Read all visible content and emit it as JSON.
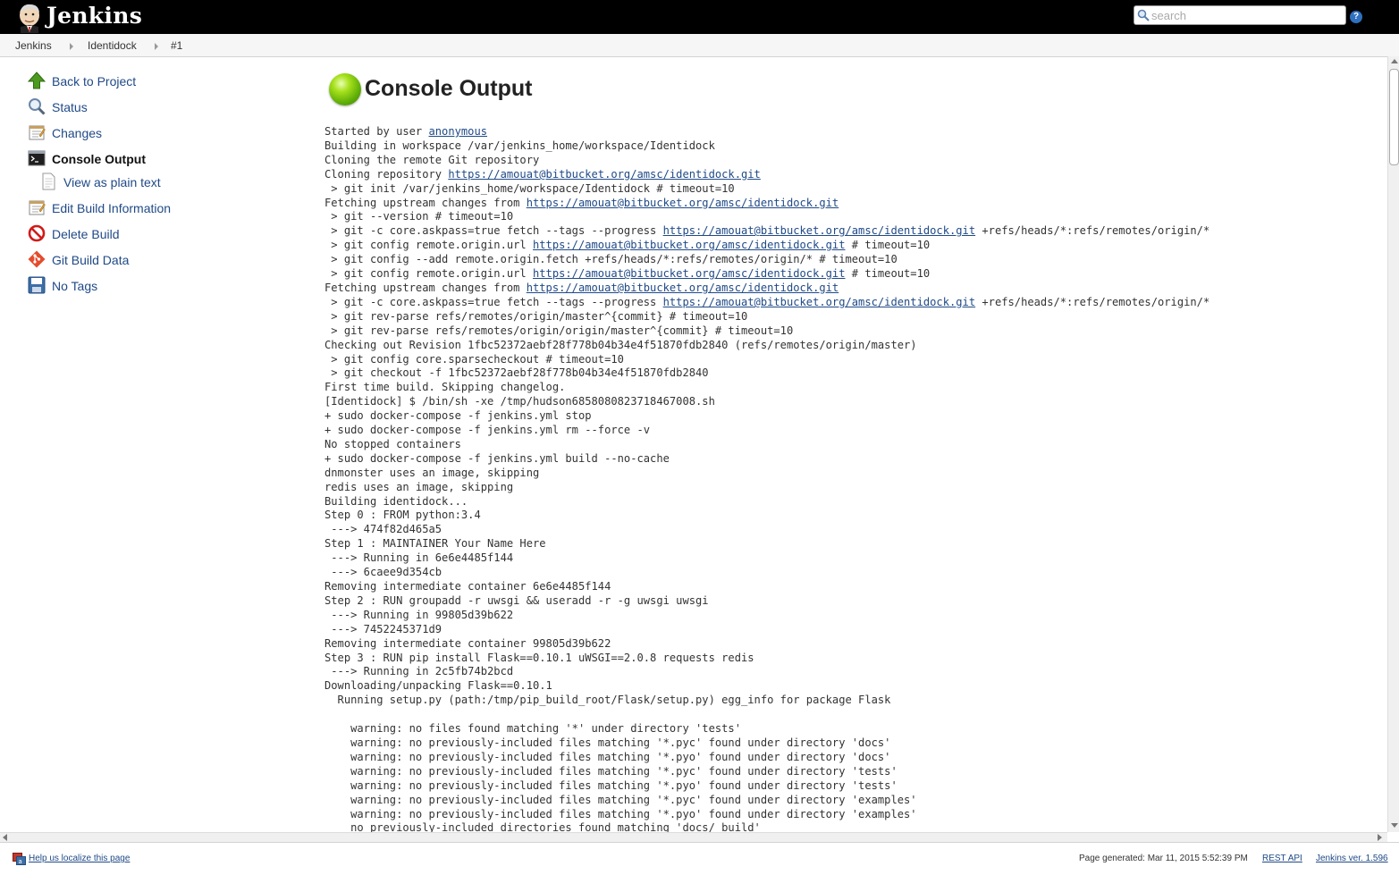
{
  "header": {
    "logo_text": "Jenkins",
    "search_placeholder": "search",
    "help_label": "?"
  },
  "breadcrumb": [
    "Jenkins",
    "Identidock",
    "#1"
  ],
  "sidebar": {
    "items": [
      {
        "label": "Back to Project",
        "icon": "up-arrow-icon"
      },
      {
        "label": "Status",
        "icon": "magnifier-icon"
      },
      {
        "label": "Changes",
        "icon": "notepad-icon"
      },
      {
        "label": "Console Output",
        "icon": "terminal-icon",
        "active": true
      },
      {
        "label": "View as plain text",
        "icon": "document-icon"
      },
      {
        "label": "Edit Build Information",
        "icon": "notepad-icon"
      },
      {
        "label": "Delete Build",
        "icon": "no-entry-icon"
      },
      {
        "label": "Git Build Data",
        "icon": "git-icon"
      },
      {
        "label": "No Tags",
        "icon": "save-icon"
      }
    ]
  },
  "main": {
    "title": "Console Output",
    "status_color": "#6cbf0c"
  },
  "console": {
    "lines": [
      [
        [
          "Started by user ",
          ""
        ],
        [
          "anonymous",
          "link"
        ]
      ],
      [
        [
          "Building in workspace /var/jenkins_home/workspace/Identidock",
          ""
        ]
      ],
      [
        [
          "Cloning the remote Git repository",
          ""
        ]
      ],
      [
        [
          "Cloning repository ",
          ""
        ],
        [
          "https://amouat@bitbucket.org/amsc/identidock.git",
          "link"
        ]
      ],
      [
        [
          " > git init /var/jenkins_home/workspace/Identidock # timeout=10",
          ""
        ]
      ],
      [
        [
          "Fetching upstream changes from ",
          ""
        ],
        [
          "https://amouat@bitbucket.org/amsc/identidock.git",
          "link"
        ]
      ],
      [
        [
          " > git --version # timeout=10",
          ""
        ]
      ],
      [
        [
          " > git -c core.askpass=true fetch --tags --progress ",
          ""
        ],
        [
          "https://amouat@bitbucket.org/amsc/identidock.git",
          "link"
        ],
        [
          " +refs/heads/*:refs/remotes/origin/*",
          ""
        ]
      ],
      [
        [
          " > git config remote.origin.url ",
          ""
        ],
        [
          "https://amouat@bitbucket.org/amsc/identidock.git",
          "link"
        ],
        [
          " # timeout=10",
          ""
        ]
      ],
      [
        [
          " > git config --add remote.origin.fetch +refs/heads/*:refs/remotes/origin/* # timeout=10",
          ""
        ]
      ],
      [
        [
          " > git config remote.origin.url ",
          ""
        ],
        [
          "https://amouat@bitbucket.org/amsc/identidock.git",
          "link"
        ],
        [
          " # timeout=10",
          ""
        ]
      ],
      [
        [
          "Fetching upstream changes from ",
          ""
        ],
        [
          "https://amouat@bitbucket.org/amsc/identidock.git",
          "link"
        ]
      ],
      [
        [
          " > git -c core.askpass=true fetch --tags --progress ",
          ""
        ],
        [
          "https://amouat@bitbucket.org/amsc/identidock.git",
          "link"
        ],
        [
          " +refs/heads/*:refs/remotes/origin/*",
          ""
        ]
      ],
      [
        [
          " > git rev-parse refs/remotes/origin/master^{commit} # timeout=10",
          ""
        ]
      ],
      [
        [
          " > git rev-parse refs/remotes/origin/origin/master^{commit} # timeout=10",
          ""
        ]
      ],
      [
        [
          "Checking out Revision 1fbc52372aebf28f778b04b34e4f51870fdb2840 (refs/remotes/origin/master)",
          ""
        ]
      ],
      [
        [
          " > git config core.sparsecheckout # timeout=10",
          ""
        ]
      ],
      [
        [
          " > git checkout -f 1fbc52372aebf28f778b04b34e4f51870fdb2840",
          ""
        ]
      ],
      [
        [
          "First time build. Skipping changelog.",
          ""
        ]
      ],
      [
        [
          "[Identidock] $ /bin/sh -xe /tmp/hudson6858080823718467008.sh",
          ""
        ]
      ],
      [
        [
          "+ sudo docker-compose -f jenkins.yml stop",
          ""
        ]
      ],
      [
        [
          "+ sudo docker-compose -f jenkins.yml rm --force -v",
          ""
        ]
      ],
      [
        [
          "No stopped containers",
          ""
        ]
      ],
      [
        [
          "+ sudo docker-compose -f jenkins.yml build --no-cache",
          ""
        ]
      ],
      [
        [
          "dnmonster uses an image, skipping",
          ""
        ]
      ],
      [
        [
          "redis uses an image, skipping",
          ""
        ]
      ],
      [
        [
          "Building identidock...",
          ""
        ]
      ],
      [
        [
          "Step 0 : FROM python:3.4",
          ""
        ]
      ],
      [
        [
          " ---> 474f82d465a5",
          ""
        ]
      ],
      [
        [
          "Step 1 : MAINTAINER Your Name Here",
          ""
        ]
      ],
      [
        [
          " ---> Running in 6e6e4485f144",
          ""
        ]
      ],
      [
        [
          " ---> 6caee9d354cb",
          ""
        ]
      ],
      [
        [
          "Removing intermediate container 6e6e4485f144",
          ""
        ]
      ],
      [
        [
          "Step 2 : RUN groupadd -r uwsgi && useradd -r -g uwsgi uwsgi",
          ""
        ]
      ],
      [
        [
          " ---> Running in 99805d39b622",
          ""
        ]
      ],
      [
        [
          " ---> 7452245371d9",
          ""
        ]
      ],
      [
        [
          "Removing intermediate container 99805d39b622",
          ""
        ]
      ],
      [
        [
          "Step 3 : RUN pip install Flask==0.10.1 uWSGI==2.0.8 requests redis",
          ""
        ]
      ],
      [
        [
          " ---> Running in 2c5fb74b2bcd",
          ""
        ]
      ],
      [
        [
          "Downloading/unpacking Flask==0.10.1",
          ""
        ]
      ],
      [
        [
          "  Running setup.py (path:/tmp/pip_build_root/Flask/setup.py) egg_info for package Flask",
          ""
        ]
      ],
      [
        [
          "",
          ""
        ]
      ],
      [
        [
          "    warning: no files found matching '*' under directory 'tests'",
          ""
        ]
      ],
      [
        [
          "    warning: no previously-included files matching '*.pyc' found under directory 'docs'",
          ""
        ]
      ],
      [
        [
          "    warning: no previously-included files matching '*.pyo' found under directory 'docs'",
          ""
        ]
      ],
      [
        [
          "    warning: no previously-included files matching '*.pyc' found under directory 'tests'",
          ""
        ]
      ],
      [
        [
          "    warning: no previously-included files matching '*.pyo' found under directory 'tests'",
          ""
        ]
      ],
      [
        [
          "    warning: no previously-included files matching '*.pyc' found under directory 'examples'",
          ""
        ]
      ],
      [
        [
          "    warning: no previously-included files matching '*.pyo' found under directory 'examples'",
          ""
        ]
      ],
      [
        [
          "    no previously-included directories found matching 'docs/_build'",
          ""
        ]
      ]
    ]
  },
  "footer": {
    "localize_label": "Help us localize this page",
    "generated_label": "Page generated: Mar 11, 2015 5:52:39 PM",
    "rest_api_label": "REST API",
    "version_label": "Jenkins ver. 1.596"
  }
}
